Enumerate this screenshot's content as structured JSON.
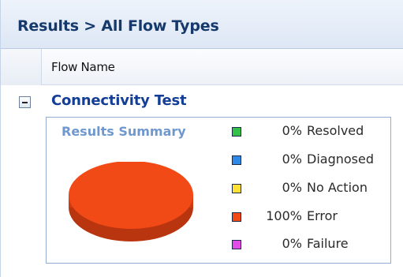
{
  "header": {
    "title": "Results > All Flow Types"
  },
  "columns": {
    "flow_name": "Flow Name"
  },
  "group": {
    "title": "Connectivity Test"
  },
  "summary": {
    "label": "Results Summary"
  },
  "chart_data": {
    "type": "pie",
    "categories": [
      "Resolved",
      "Diagnosed",
      "No Action",
      "Error",
      "Failure"
    ],
    "values": [
      0,
      0,
      0,
      100,
      0
    ],
    "colors": [
      "#33c14a",
      "#2e8ae6",
      "#ffe033",
      "#f24a17",
      "#e14de6"
    ]
  },
  "legend": [
    {
      "pct": "0%",
      "label": "Resolved",
      "color": "#33c14a"
    },
    {
      "pct": "0%",
      "label": "Diagnosed",
      "color": "#2e8ae6"
    },
    {
      "pct": "0%",
      "label": "No Action",
      "color": "#ffe033"
    },
    {
      "pct": "100%",
      "label": "Error",
      "color": "#f24a17"
    },
    {
      "pct": "0%",
      "label": "Failure",
      "color": "#e14de6"
    }
  ],
  "icons": {
    "expander": "collapse-minus-icon"
  }
}
